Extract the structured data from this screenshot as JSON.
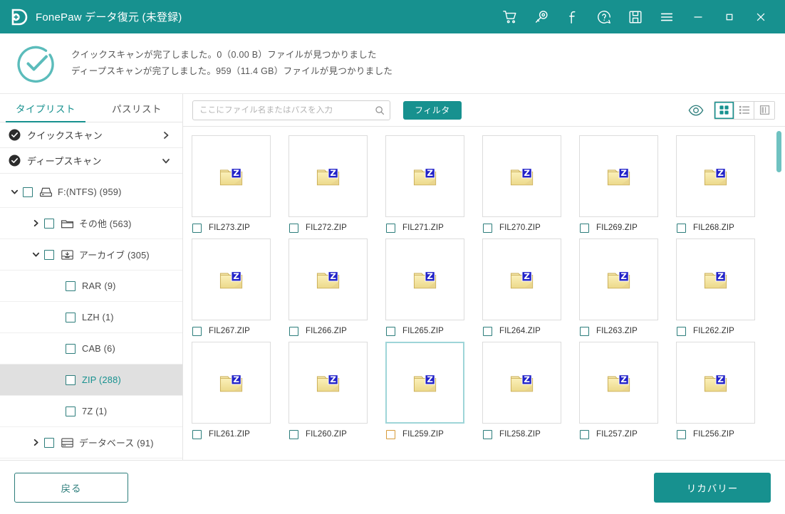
{
  "titlebar": {
    "app_title": "FonePaw データ復元 (未登録)",
    "logo_icon": "fonepaw-logo-icon",
    "icons": [
      {
        "name": "cart-icon",
        "label": "cart"
      },
      {
        "name": "key-icon",
        "label": "key"
      },
      {
        "name": "facebook-icon",
        "label": "facebook"
      },
      {
        "name": "help-icon",
        "label": "help"
      },
      {
        "name": "save-icon",
        "label": "save"
      },
      {
        "name": "menu-icon",
        "label": "menu"
      },
      {
        "name": "minimize-icon",
        "label": "minimize"
      },
      {
        "name": "maximize-icon",
        "label": "maximize"
      },
      {
        "name": "close-icon",
        "label": "close"
      }
    ]
  },
  "status": {
    "icon": "success-check-circle-icon",
    "line1": "クイックスキャンが完了しました。0（0.00 B）ファイルが見つかりました",
    "line2": "ディープスキャンが完了しました。959（11.4 GB）ファイルが見つかりました"
  },
  "sidebar": {
    "tabs": [
      {
        "label": "タイプリスト",
        "active": true
      },
      {
        "label": "パスリスト",
        "active": false
      }
    ],
    "scan_rows": [
      {
        "label": "クイックスキャン",
        "chevron": "chevron-right-icon",
        "expanded": false
      },
      {
        "label": "ディープスキャン",
        "chevron": "chevron-down-icon",
        "expanded": true
      }
    ],
    "tree": [
      {
        "label": "F:(NTFS) (959)",
        "indent": 0,
        "twisty": "chevron-down-icon",
        "checkbox": true,
        "icon": "drive-icon",
        "selected": false
      },
      {
        "label": "その他 (563)",
        "indent": 1,
        "twisty": "chevron-right-icon",
        "checkbox": true,
        "icon": "folder-icon",
        "selected": false
      },
      {
        "label": "アーカイブ (305)",
        "indent": 1,
        "twisty": "chevron-down-icon",
        "checkbox": true,
        "icon": "archive-icon",
        "selected": false
      },
      {
        "label": "RAR (9)",
        "indent": 2,
        "twisty": "",
        "checkbox": true,
        "icon": "",
        "selected": false
      },
      {
        "label": "LZH (1)",
        "indent": 2,
        "twisty": "",
        "checkbox": true,
        "icon": "",
        "selected": false
      },
      {
        "label": "CAB (6)",
        "indent": 2,
        "twisty": "",
        "checkbox": true,
        "icon": "",
        "selected": false
      },
      {
        "label": "ZIP (288)",
        "indent": 2,
        "twisty": "",
        "checkbox": true,
        "icon": "",
        "selected": true
      },
      {
        "label": "7Z (1)",
        "indent": 2,
        "twisty": "",
        "checkbox": true,
        "icon": "",
        "selected": false
      },
      {
        "label": "データベース (91)",
        "indent": 1,
        "twisty": "chevron-right-icon",
        "checkbox": true,
        "icon": "database-icon",
        "selected": false
      }
    ]
  },
  "toolbar": {
    "search_placeholder": "ここにファイル名またはパスを入力",
    "search_value": "",
    "search_icon": "search-icon",
    "filter_label": "フィルタ",
    "preview_icon": "eye-icon",
    "views": [
      {
        "name": "grid-view",
        "icon": "grid-view-icon",
        "active": true
      },
      {
        "name": "list-view",
        "icon": "list-view-icon",
        "active": false
      },
      {
        "name": "detail-view",
        "icon": "detail-view-icon",
        "active": false
      }
    ]
  },
  "files": [
    {
      "name": "FIL273.ZIP",
      "icon": "zip-folder-icon",
      "selected": false,
      "checked": false
    },
    {
      "name": "FIL272.ZIP",
      "icon": "zip-folder-icon",
      "selected": false,
      "checked": false
    },
    {
      "name": "FIL271.ZIP",
      "icon": "zip-folder-icon",
      "selected": false,
      "checked": false
    },
    {
      "name": "FIL270.ZIP",
      "icon": "zip-folder-icon",
      "selected": false,
      "checked": false
    },
    {
      "name": "FIL269.ZIP",
      "icon": "zip-folder-icon",
      "selected": false,
      "checked": false
    },
    {
      "name": "FIL268.ZIP",
      "icon": "zip-folder-icon",
      "selected": false,
      "checked": false
    },
    {
      "name": "FIL267.ZIP",
      "icon": "zip-folder-icon",
      "selected": false,
      "checked": false
    },
    {
      "name": "FIL266.ZIP",
      "icon": "zip-folder-icon",
      "selected": false,
      "checked": false
    },
    {
      "name": "FIL265.ZIP",
      "icon": "zip-folder-icon",
      "selected": false,
      "checked": false
    },
    {
      "name": "FIL264.ZIP",
      "icon": "zip-folder-icon",
      "selected": false,
      "checked": false
    },
    {
      "name": "FIL263.ZIP",
      "icon": "zip-folder-icon",
      "selected": false,
      "checked": false
    },
    {
      "name": "FIL262.ZIP",
      "icon": "zip-folder-icon",
      "selected": false,
      "checked": false
    },
    {
      "name": "FIL261.ZIP",
      "icon": "zip-folder-icon",
      "selected": false,
      "checked": false
    },
    {
      "name": "FIL260.ZIP",
      "icon": "zip-folder-icon",
      "selected": false,
      "checked": false
    },
    {
      "name": "FIL259.ZIP",
      "icon": "zip-folder-icon",
      "selected": true,
      "checked": false
    },
    {
      "name": "FIL258.ZIP",
      "icon": "zip-folder-icon",
      "selected": false,
      "checked": false
    },
    {
      "name": "FIL257.ZIP",
      "icon": "zip-folder-icon",
      "selected": false,
      "checked": false
    },
    {
      "name": "FIL256.ZIP",
      "icon": "zip-folder-icon",
      "selected": false,
      "checked": false
    }
  ],
  "footer": {
    "back_label": "戻る",
    "recover_label": "リカバリー"
  },
  "colors": {
    "accent": "#17918f",
    "accent_dark": "#2c7d7b",
    "selected_tile_border": "#9ed5d8",
    "orange_checkbox": "#d79b3a",
    "scrollbar": "#6fc2c1"
  }
}
